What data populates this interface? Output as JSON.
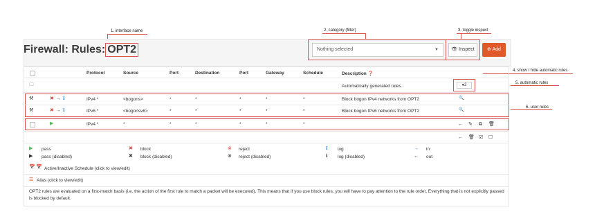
{
  "title": {
    "prefix": "Firewall: Rules:",
    "interface": "OPT2"
  },
  "callouts": {
    "c1": "1. interface name",
    "c2": "2. category (filter)",
    "c3": "3. toggle inspect",
    "c4": "4. show / hide automatic rules",
    "c5": "5. automatic rules",
    "c6": "6. user rules"
  },
  "toolbar": {
    "category_value": "Nothing selected",
    "inspect_label": "Inspect",
    "add_label": "Add"
  },
  "table": {
    "headers": [
      "Protocol",
      "Source",
      "Port",
      "Destination",
      "Port",
      "Gateway",
      "Schedule",
      "Description"
    ],
    "auto_group_label": "Automatically generated rules",
    "auto_count": "2",
    "rows": [
      {
        "protocol": "IPv4 *",
        "source": "<bogons>",
        "port": "*",
        "destination": "*",
        "dport": "*",
        "gateway": "*",
        "schedule": "*",
        "description": "Block bogon IPv4 networks from OPT2"
      },
      {
        "protocol": "IPv6 *",
        "source": "<bogonsv6>",
        "port": "*",
        "destination": "*",
        "dport": "*",
        "gateway": "*",
        "schedule": "*",
        "description": "Block bogon IPv6 networks from OPT2"
      },
      {
        "protocol": "IPv4 *",
        "source": "*",
        "port": "*",
        "destination": "*",
        "dport": "*",
        "gateway": "*",
        "schedule": "*",
        "description": ""
      }
    ]
  },
  "legend": {
    "pass": "pass",
    "pass_disabled": "pass (disabled)",
    "block": "block",
    "block_disabled": "block (disabled)",
    "reject": "reject",
    "reject_disabled": "reject (disabled)",
    "log": "log",
    "log_disabled": "log (disabled)",
    "in": "in",
    "out": "out",
    "schedule": "Active/Inactive Schedule (click to view/edit)",
    "alias": "Alias (click to view/edit)"
  },
  "note": "OPT2 rules are evaluated on a first-match basis (i.e. the action of the first rule to match a packet will be executed). This means that if you use block rules, you will have to pay attention to the rule order. Everything that is not explicitly passed is blocked by default."
}
